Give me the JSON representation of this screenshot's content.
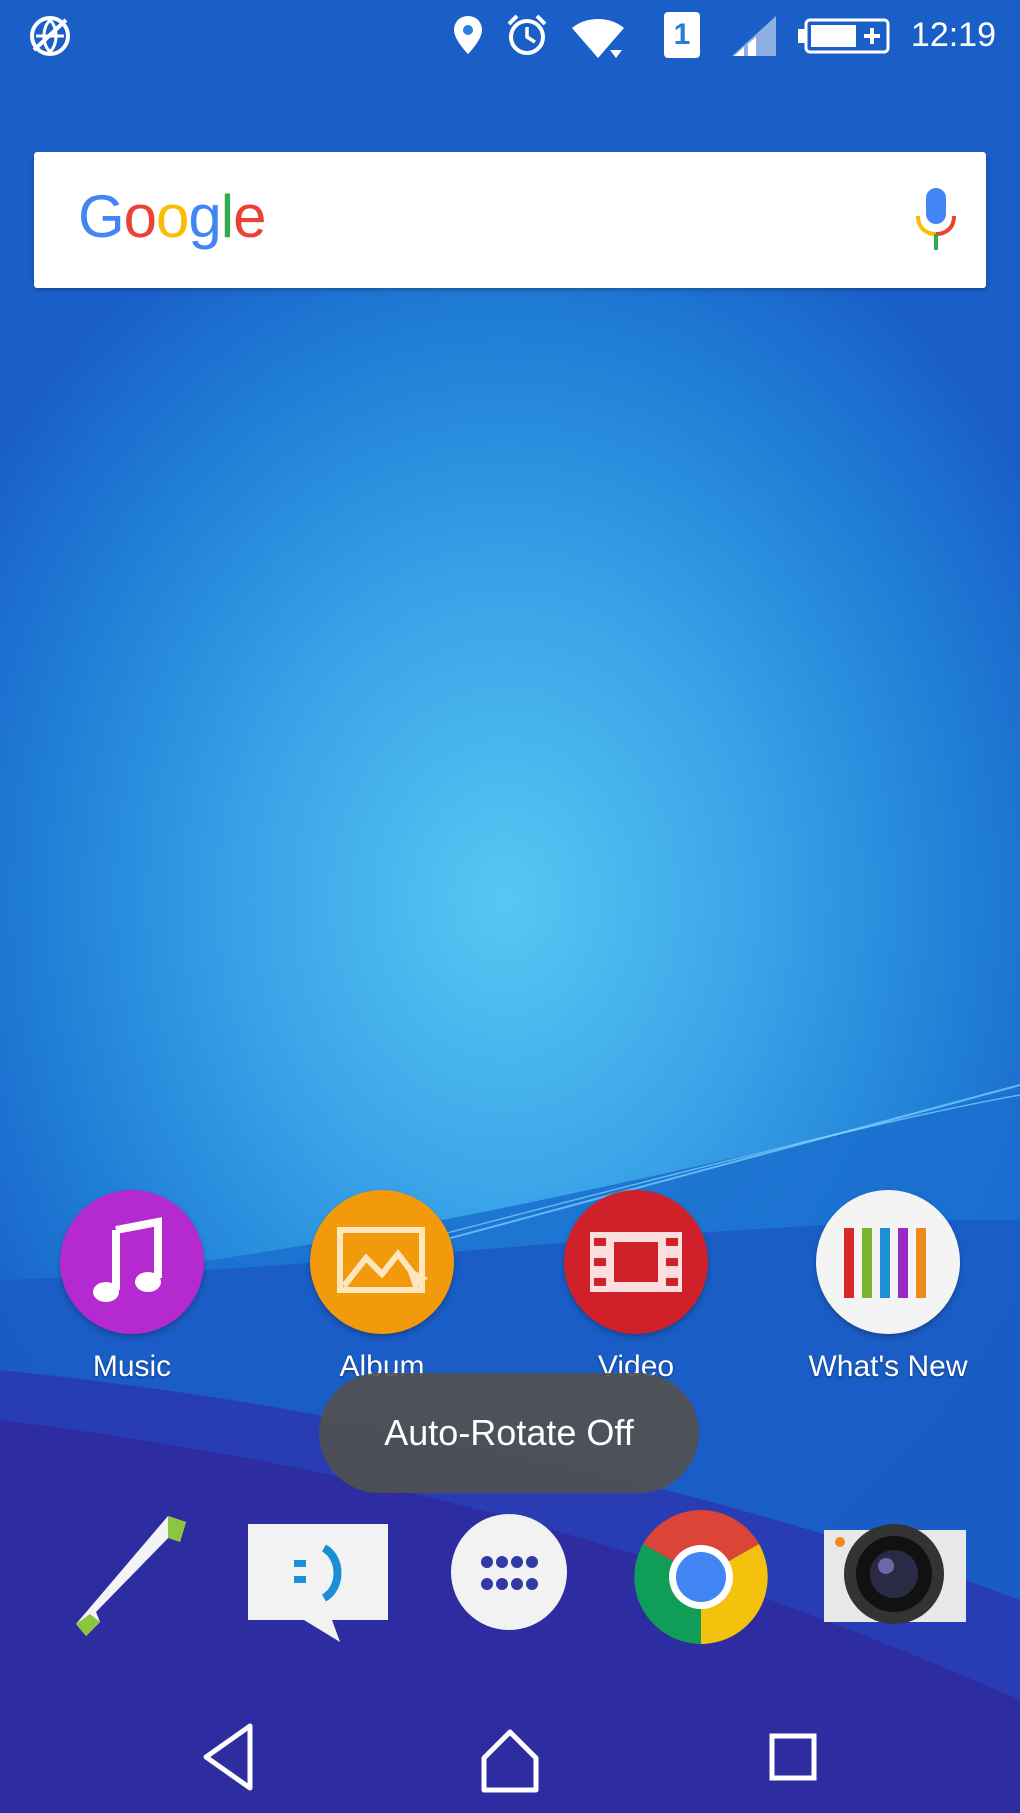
{
  "status_bar": {
    "time": "12:19",
    "sim_slot": "1",
    "icons": [
      "no-data-icon",
      "location-icon",
      "alarm-icon",
      "wifi-icon",
      "sim-icon",
      "signal-icon",
      "battery-icon"
    ]
  },
  "search": {
    "logo_letters": [
      "G",
      "o",
      "o",
      "g",
      "l",
      "e"
    ],
    "logo_colors": [
      "#4285F4",
      "#EA4335",
      "#FBBC05",
      "#4285F4",
      "#34A853",
      "#EA4335"
    ]
  },
  "apps": [
    {
      "label": "Music",
      "icon": "music-icon",
      "color": "#b42ad0"
    },
    {
      "label": "Album",
      "icon": "album-icon",
      "color": "#f29a0c"
    },
    {
      "label": "Video",
      "icon": "video-icon",
      "color": "#d0202a"
    },
    {
      "label": "What's New",
      "icon": "whats-new-icon",
      "color": "#f4f4f4"
    }
  ],
  "toast": {
    "text": "Auto-Rotate Off"
  },
  "dock": [
    "phone-icon",
    "messaging-icon",
    "app-drawer-icon",
    "chrome-icon",
    "camera-icon"
  ],
  "nav": [
    "back-icon",
    "home-icon",
    "recents-icon"
  ]
}
